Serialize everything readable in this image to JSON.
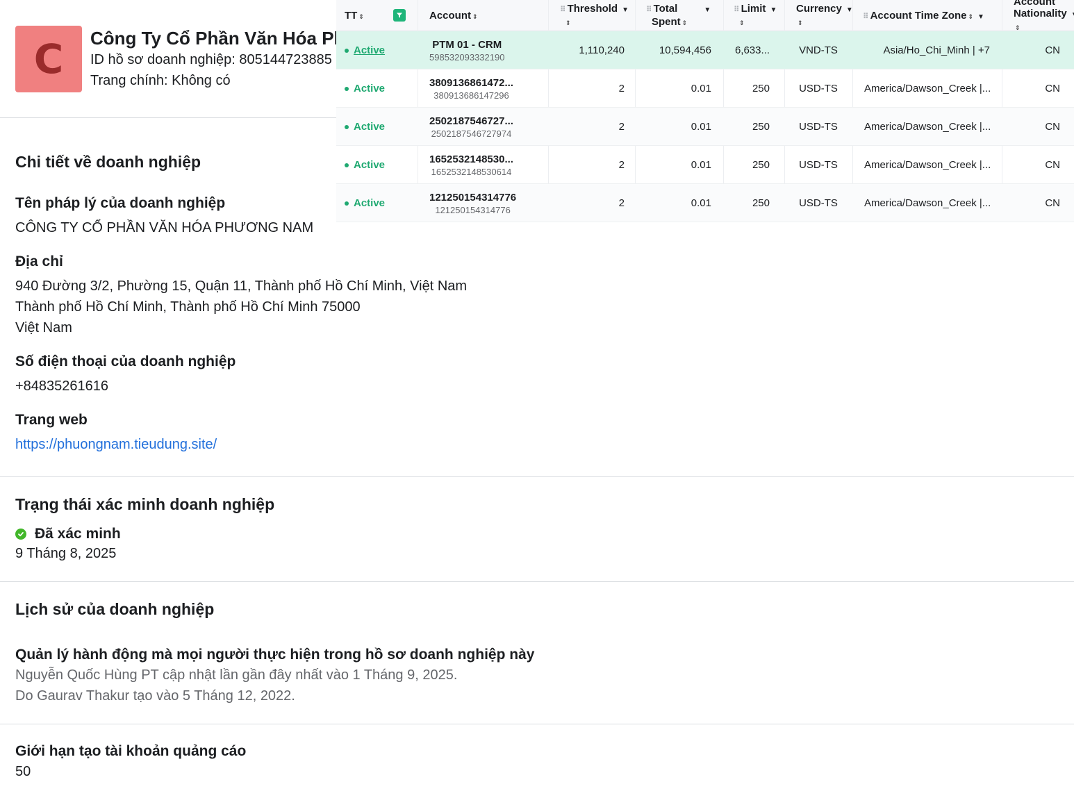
{
  "profile": {
    "avatar_letter": "C",
    "company_name": "Công Ty Cổ Phần Văn Hóa Phương Nam",
    "business_id": "ID hồ sơ doanh nghiệp: 805144723885",
    "main_page": "Trang chính: Không có"
  },
  "details": {
    "section_title": "Chi tiết về doanh nghiệp",
    "legal_name_label": "Tên pháp lý của doanh nghiệp",
    "legal_name_value": "CÔNG TY CỔ PHẦN VĂN HÓA PHƯƠNG NAM",
    "address_label": "Địa chỉ",
    "address_line1": "940 Đường 3/2, Phường 15, Quận 11, Thành phố Hồ Chí Minh, Việt Nam",
    "address_line2": "Thành phố Hồ Chí Minh, Thành phố Hồ Chí Minh 75000",
    "address_line3": "Việt Nam",
    "phone_label": "Số điện thoại của doanh nghiệp",
    "phone_value": "+84835261616",
    "website_label": "Trang web",
    "website_value": "https://phuongnam.tieudung.site/"
  },
  "verification": {
    "section_title": "Trạng thái xác minh doanh nghiệp",
    "status": "Đã xác minh",
    "date": "9 Tháng 8, 2025"
  },
  "history": {
    "section_title": "Lịch sử của doanh nghiệp",
    "manage_label": "Quản lý hành động mà mọi người thực hiện trong hồ sơ doanh nghiệp này",
    "updated_text": "Nguyễn Quốc Hùng PT cập nhật lần gần đây nhất vào 1 Tháng 9, 2025.",
    "created_text": "Do Gaurav Thakur tạo vào 5 Tháng 12, 2022."
  },
  "ad_limit": {
    "label": "Giới hạn tạo tài khoản quảng cáo",
    "value": "50"
  },
  "table": {
    "headers": {
      "tt": "TT",
      "account": "Account",
      "threshold": "Threshold",
      "total_spent_1": "Total",
      "total_spent_2": "Spent",
      "limit": "Limit",
      "currency": "Currency",
      "time_zone": "Account Time Zone",
      "nationality_1": "Account",
      "nationality_2": "Nationality"
    },
    "rows": [
      {
        "status": "Active",
        "name": "PTM 01 - CRM",
        "id": "598532093332190",
        "threshold": "1,110,240",
        "spent": "10,594,456",
        "limit": "6,633...",
        "currency": "VND-TS",
        "tz": "Asia/Ho_Chi_Minh | +7",
        "nationality": "CN"
      },
      {
        "status": "Active",
        "name": "3809136861472...",
        "id": "380913686147296",
        "threshold": "2",
        "spent": "0.01",
        "limit": "250",
        "currency": "USD-TS",
        "tz": "America/Dawson_Creek |...",
        "nationality": "CN"
      },
      {
        "status": "Active",
        "name": "2502187546727...",
        "id": "2502187546727974",
        "threshold": "2",
        "spent": "0.01",
        "limit": "250",
        "currency": "USD-TS",
        "tz": "America/Dawson_Creek |...",
        "nationality": "CN"
      },
      {
        "status": "Active",
        "name": "1652532148530...",
        "id": "1652532148530614",
        "threshold": "2",
        "spent": "0.01",
        "limit": "250",
        "currency": "USD-TS",
        "tz": "America/Dawson_Creek |...",
        "nationality": "CN"
      },
      {
        "status": "Active",
        "name": "121250154314776",
        "id": "121250154314776",
        "threshold": "2",
        "spent": "0.01",
        "limit": "250",
        "currency": "USD-TS",
        "tz": "America/Dawson_Creek |...",
        "nationality": "CN"
      }
    ]
  },
  "colors": {
    "accent_green": "#1fa971",
    "highlight_row": "#dbf5ec",
    "link_blue": "#216fdb",
    "avatar_bg": "#f08080"
  }
}
